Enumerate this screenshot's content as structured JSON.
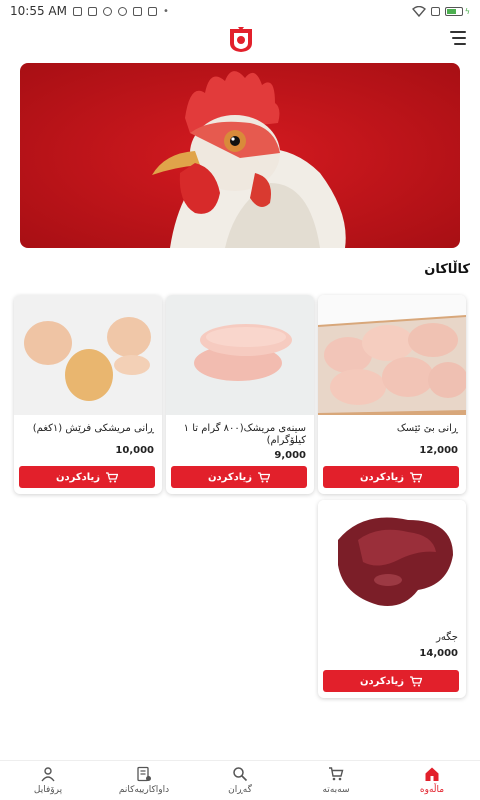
{
  "status_bar": {
    "time": "10:55 AM"
  },
  "section_title": "کاڵاکان",
  "products": [
    {
      "name": "ڕانی بێ ئێسک",
      "price": "12,000",
      "add_label": "زیادکردن"
    },
    {
      "name": "سینەی مریشک(٨٠٠ گرام تا ١ کیلۆگرام)",
      "price": "9,000",
      "add_label": "زیادکردن"
    },
    {
      "name": "ڕانی مریشکی فرێش (١کغم)",
      "price": "10,000",
      "add_label": "زیادکردن"
    },
    {
      "name": "جگەر",
      "price": "14,000",
      "add_label": "زیادکردن"
    }
  ],
  "bottom_nav": [
    {
      "label": "ماڵەوە",
      "icon": "home-icon",
      "active": true
    },
    {
      "label": "سەبەتە",
      "icon": "cart-icon",
      "active": false
    },
    {
      "label": "گەڕان",
      "icon": "search-icon",
      "active": false
    },
    {
      "label": "داواکارییەکانم",
      "icon": "orders-icon",
      "active": false
    },
    {
      "label": "پرۆفایل",
      "icon": "profile-icon",
      "active": false
    }
  ],
  "colors": {
    "accent": "#e2202b",
    "banner_bg": "#c8161c"
  }
}
